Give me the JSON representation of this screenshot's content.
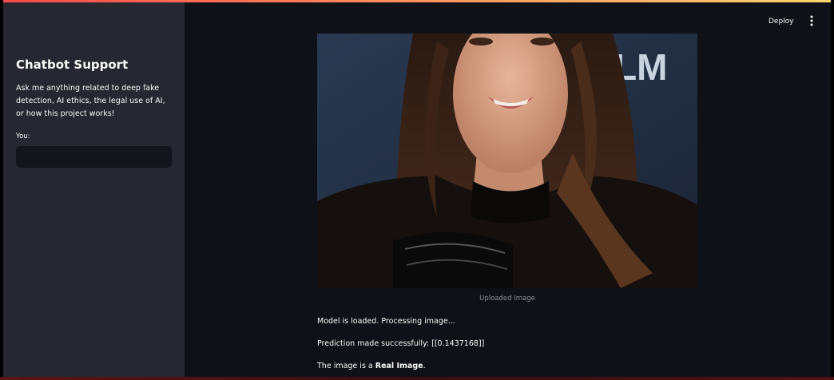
{
  "header": {
    "deploy_label": "Deploy",
    "menu_icon": "vertical-ellipsis-icon"
  },
  "sidebar": {
    "title": "Chatbot Support",
    "description": "Ask me anything related to deep fake detection, AI ethics, the legal use of AI, or how this project works!",
    "input_label": "You:",
    "input_value": "",
    "input_placeholder": ""
  },
  "main": {
    "image_caption": "Uploaded Image",
    "status_loaded": "Model is loaded. Processing image...",
    "prediction_text": "Prediction made successfully: [[0.1437168]]",
    "result_prefix": "The image is a ",
    "result_value": "Real Image",
    "result_suffix": "."
  },
  "colors": {
    "background": "#0e1117",
    "sidebar": "#262730",
    "input": "#13151c",
    "text": "#fafafa",
    "caption": "#8d8f96",
    "accent_start": "#ff4b4b",
    "accent_end": "#ffd36b"
  }
}
